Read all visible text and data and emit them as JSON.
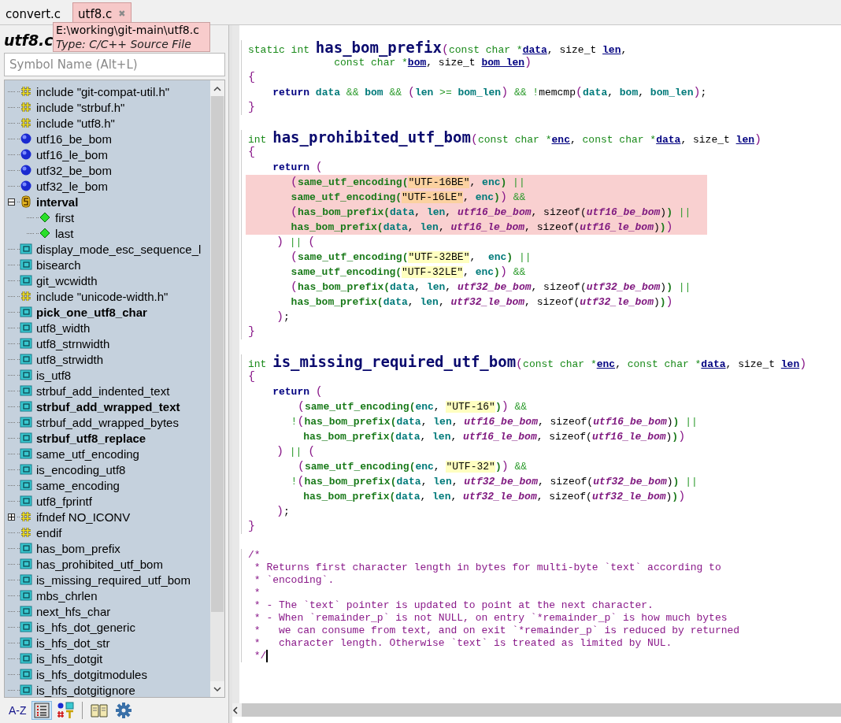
{
  "tabs": [
    {
      "label": "convert.c",
      "selected": false,
      "closable": false
    },
    {
      "label": "utf8.c",
      "selected": true,
      "closable": true,
      "close_glyph": "✖"
    }
  ],
  "tooltip": {
    "path": "E:\\working\\git-main\\utf8.c",
    "type": "Type: C/C++ Source File"
  },
  "outline": {
    "title": "utf8.c",
    "search": {
      "placeholder": "Symbol Name (Alt+L)"
    },
    "items": [
      {
        "kind": "include",
        "label": "include \"git-compat-util.h\"",
        "bold": false
      },
      {
        "kind": "include",
        "label": "include \"strbuf.h\"",
        "bold": false
      },
      {
        "kind": "include",
        "label": "include \"utf8.h\"",
        "bold": false
      },
      {
        "kind": "global",
        "label": "utf16_be_bom",
        "bold": false
      },
      {
        "kind": "global",
        "label": "utf16_le_bom",
        "bold": false
      },
      {
        "kind": "global",
        "label": "utf32_be_bom",
        "bold": false
      },
      {
        "kind": "global",
        "label": "utf32_le_bom",
        "bold": false
      },
      {
        "kind": "struct",
        "label": "interval",
        "bold": true,
        "expanded": true,
        "children": [
          {
            "kind": "field",
            "label": "first",
            "bold": false
          },
          {
            "kind": "field",
            "label": "last",
            "bold": false
          }
        ]
      },
      {
        "kind": "function",
        "label": "display_mode_esc_sequence_l",
        "bold": false
      },
      {
        "kind": "function",
        "label": "bisearch",
        "bold": false
      },
      {
        "kind": "function",
        "label": "git_wcwidth",
        "bold": false
      },
      {
        "kind": "include",
        "label": "include \"unicode-width.h\"",
        "bold": false
      },
      {
        "kind": "function",
        "label": "pick_one_utf8_char",
        "bold": true
      },
      {
        "kind": "function",
        "label": "utf8_width",
        "bold": false
      },
      {
        "kind": "function",
        "label": "utf8_strnwidth",
        "bold": false
      },
      {
        "kind": "function",
        "label": "utf8_strwidth",
        "bold": false
      },
      {
        "kind": "function",
        "label": "is_utf8",
        "bold": false
      },
      {
        "kind": "function",
        "label": "strbuf_add_indented_text",
        "bold": false
      },
      {
        "kind": "function",
        "label": "strbuf_add_wrapped_text",
        "bold": true
      },
      {
        "kind": "function",
        "label": "strbuf_add_wrapped_bytes",
        "bold": false
      },
      {
        "kind": "function",
        "label": "strbuf_utf8_replace",
        "bold": true
      },
      {
        "kind": "function",
        "label": "same_utf_encoding",
        "bold": false
      },
      {
        "kind": "function",
        "label": "is_encoding_utf8",
        "bold": false
      },
      {
        "kind": "function",
        "label": "same_encoding",
        "bold": false
      },
      {
        "kind": "function",
        "label": "utf8_fprintf",
        "bold": false
      },
      {
        "kind": "include",
        "label": "ifndef NO_ICONV",
        "bold": false,
        "expanded": false
      },
      {
        "kind": "include",
        "label": "endif",
        "bold": false
      },
      {
        "kind": "function",
        "label": "has_bom_prefix",
        "bold": false
      },
      {
        "kind": "function",
        "label": "has_prohibited_utf_bom",
        "bold": false
      },
      {
        "kind": "function",
        "label": "is_missing_required_utf_bom",
        "bold": false
      },
      {
        "kind": "function",
        "label": "mbs_chrlen",
        "bold": false
      },
      {
        "kind": "function",
        "label": "next_hfs_char",
        "bold": false
      },
      {
        "kind": "function",
        "label": "is_hfs_dot_generic",
        "bold": false
      },
      {
        "kind": "function",
        "label": "is_hfs_dot_str",
        "bold": false
      },
      {
        "kind": "function",
        "label": "is_hfs_dotgit",
        "bold": false
      },
      {
        "kind": "function",
        "label": "is_hfs_dotgitmodules",
        "bold": false
      },
      {
        "kind": "function",
        "label": "is_hfs_dotgitignore",
        "bold": false
      }
    ],
    "toolbar": [
      {
        "kind": "sort",
        "label": "A-Z",
        "selected": false
      },
      {
        "kind": "list",
        "selected": true
      },
      {
        "kind": "symbols",
        "selected": false
      },
      {
        "kind": "book",
        "selected": false
      },
      {
        "kind": "gear",
        "selected": false
      }
    ]
  },
  "editor": {
    "blocks": [
      {
        "lines": [
          {
            "highlighted": false,
            "tokens": [
              {
                "kind": "keyword",
                "text": "static int "
              },
              {
                "kind": "definition",
                "text": "has_bom_prefix"
              },
              {
                "kind": "paren",
                "text": "("
              },
              {
                "kind": "keyword",
                "text": "const char *"
              },
              {
                "kind": "param",
                "text": "data"
              },
              {
                "kind": "plain",
                "text": ", size_t "
              },
              {
                "kind": "param",
                "text": "len"
              },
              {
                "kind": "plain",
                "text": ","
              }
            ]
          },
          {
            "highlighted": false,
            "tokens": [
              {
                "kind": "keyword",
                "text": "              const char *"
              },
              {
                "kind": "param",
                "text": "bom"
              },
              {
                "kind": "plain",
                "text": ", size_t "
              },
              {
                "kind": "param",
                "text": "bom_len"
              },
              {
                "kind": "paren",
                "text": ")"
              }
            ]
          },
          {
            "highlighted": false,
            "tokens": [
              {
                "kind": "paren",
                "text": "{"
              }
            ]
          },
          {
            "highlighted": false,
            "tokens": [
              {
                "kind": "return",
                "text": "    return "
              },
              {
                "kind": "variable",
                "text": "data "
              },
              {
                "kind": "operator",
                "text": "&& "
              },
              {
                "kind": "variable",
                "text": "bom "
              },
              {
                "kind": "operator",
                "text": "&& "
              },
              {
                "kind": "paren",
                "text": "("
              },
              {
                "kind": "variable",
                "text": "len "
              },
              {
                "kind": "operator",
                "text": ">= "
              },
              {
                "kind": "variable",
                "text": "bom_len"
              },
              {
                "kind": "paren",
                "text": ")"
              },
              {
                "kind": "operator",
                "text": " && !"
              },
              {
                "kind": "plain",
                "text": "memcmp"
              },
              {
                "kind": "paren",
                "text": "("
              },
              {
                "kind": "variable",
                "text": "data"
              },
              {
                "kind": "plain",
                "text": ", "
              },
              {
                "kind": "variable",
                "text": "bom"
              },
              {
                "kind": "plain",
                "text": ", "
              },
              {
                "kind": "variable",
                "text": "bom_len"
              },
              {
                "kind": "paren",
                "text": ")"
              },
              {
                "kind": "plain",
                "text": ";"
              }
            ]
          },
          {
            "highlighted": false,
            "tokens": [
              {
                "kind": "paren",
                "text": "}"
              }
            ]
          }
        ]
      },
      {
        "lines": [
          {
            "highlighted": false,
            "tokens": [
              {
                "kind": "keyword",
                "text": "int "
              },
              {
                "kind": "definition",
                "text": "has_prohibited_utf_bom"
              },
              {
                "kind": "paren",
                "text": "("
              },
              {
                "kind": "keyword",
                "text": "const char *"
              },
              {
                "kind": "param",
                "text": "enc"
              },
              {
                "kind": "plain",
                "text": ", "
              },
              {
                "kind": "keyword",
                "text": "const char *"
              },
              {
                "kind": "param",
                "text": "data"
              },
              {
                "kind": "plain",
                "text": ", size_t "
              },
              {
                "kind": "param",
                "text": "len"
              },
              {
                "kind": "paren",
                "text": ")"
              }
            ]
          },
          {
            "highlighted": false,
            "tokens": [
              {
                "kind": "paren",
                "text": "{"
              }
            ]
          },
          {
            "highlighted": false,
            "tokens": [
              {
                "kind": "return",
                "text": "    return "
              },
              {
                "kind": "paren",
                "text": "("
              }
            ]
          },
          {
            "highlighted": true,
            "tokens": [
              {
                "kind": "paren",
                "text": "      ("
              },
              {
                "kind": "call",
                "text": "same_utf_encoding("
              },
              {
                "kind": "string",
                "text": "\"UTF-16BE\""
              },
              {
                "kind": "plain",
                "text": ", "
              },
              {
                "kind": "variable",
                "text": "enc"
              },
              {
                "kind": "call",
                "text": ")"
              },
              {
                "kind": "operator",
                "text": " ||"
              }
            ]
          },
          {
            "highlighted": true,
            "tokens": [
              {
                "kind": "call",
                "text": "       same_utf_encoding("
              },
              {
                "kind": "string",
                "text": "\"UTF-16LE\""
              },
              {
                "kind": "plain",
                "text": ", "
              },
              {
                "kind": "variable",
                "text": "enc"
              },
              {
                "kind": "call",
                "text": ")"
              },
              {
                "kind": "paren",
                "text": ")"
              },
              {
                "kind": "operator",
                "text": " &&"
              }
            ]
          },
          {
            "highlighted": true,
            "tokens": [
              {
                "kind": "paren",
                "text": "      ("
              },
              {
                "kind": "call",
                "text": "has_bom_prefix("
              },
              {
                "kind": "variable",
                "text": "data"
              },
              {
                "kind": "plain",
                "text": ", "
              },
              {
                "kind": "variable",
                "text": "len"
              },
              {
                "kind": "plain",
                "text": ", "
              },
              {
                "kind": "global",
                "text": "utf16_be_bom"
              },
              {
                "kind": "plain",
                "text": ", sizeof("
              },
              {
                "kind": "global",
                "text": "utf16_be_bom"
              },
              {
                "kind": "plain",
                "text": ")"
              },
              {
                "kind": "call",
                "text": ")"
              },
              {
                "kind": "operator",
                "text": " ||"
              }
            ]
          },
          {
            "highlighted": true,
            "tokens": [
              {
                "kind": "call",
                "text": "       has_bom_prefix("
              },
              {
                "kind": "variable",
                "text": "data"
              },
              {
                "kind": "plain",
                "text": ", "
              },
              {
                "kind": "variable",
                "text": "len"
              },
              {
                "kind": "plain",
                "text": ", "
              },
              {
                "kind": "global",
                "text": "utf16_le_bom"
              },
              {
                "kind": "plain",
                "text": ", sizeof("
              },
              {
                "kind": "global",
                "text": "utf16_le_bom"
              },
              {
                "kind": "plain",
                "text": ")"
              },
              {
                "kind": "call",
                "text": ")"
              },
              {
                "kind": "paren",
                "text": ")"
              }
            ]
          },
          {
            "highlighted": false,
            "tokens": [
              {
                "kind": "paren",
                "text": "    )"
              },
              {
                "kind": "operator",
                "text": " || "
              },
              {
                "kind": "paren",
                "text": "("
              }
            ]
          },
          {
            "highlighted": false,
            "tokens": [
              {
                "kind": "paren",
                "text": "      ("
              },
              {
                "kind": "call",
                "text": "same_utf_encoding("
              },
              {
                "kind": "string",
                "text": "\"UTF-32BE\""
              },
              {
                "kind": "plain",
                "text": ",  "
              },
              {
                "kind": "variable",
                "text": "enc"
              },
              {
                "kind": "call",
                "text": ")"
              },
              {
                "kind": "operator",
                "text": " ||"
              }
            ]
          },
          {
            "highlighted": false,
            "tokens": [
              {
                "kind": "call",
                "text": "       same_utf_encoding("
              },
              {
                "kind": "string",
                "text": "\"UTF-32LE\""
              },
              {
                "kind": "plain",
                "text": ", "
              },
              {
                "kind": "variable",
                "text": "enc"
              },
              {
                "kind": "call",
                "text": ")"
              },
              {
                "kind": "paren",
                "text": ")"
              },
              {
                "kind": "operator",
                "text": " &&"
              }
            ]
          },
          {
            "highlighted": false,
            "tokens": [
              {
                "kind": "paren",
                "text": "      ("
              },
              {
                "kind": "call",
                "text": "has_bom_prefix("
              },
              {
                "kind": "variable",
                "text": "data"
              },
              {
                "kind": "plain",
                "text": ", "
              },
              {
                "kind": "variable",
                "text": "len"
              },
              {
                "kind": "plain",
                "text": ", "
              },
              {
                "kind": "global",
                "text": "utf32_be_bom"
              },
              {
                "kind": "plain",
                "text": ", sizeof("
              },
              {
                "kind": "global",
                "text": "utf32_be_bom"
              },
              {
                "kind": "plain",
                "text": ")"
              },
              {
                "kind": "call",
                "text": ")"
              },
              {
                "kind": "operator",
                "text": " ||"
              }
            ]
          },
          {
            "highlighted": false,
            "tokens": [
              {
                "kind": "call",
                "text": "       has_bom_prefix("
              },
              {
                "kind": "variable",
                "text": "data"
              },
              {
                "kind": "plain",
                "text": ", "
              },
              {
                "kind": "variable",
                "text": "len"
              },
              {
                "kind": "plain",
                "text": ", "
              },
              {
                "kind": "global",
                "text": "utf32_le_bom"
              },
              {
                "kind": "plain",
                "text": ", sizeof("
              },
              {
                "kind": "global",
                "text": "utf32_le_bom"
              },
              {
                "kind": "plain",
                "text": ")"
              },
              {
                "kind": "call",
                "text": ")"
              },
              {
                "kind": "paren",
                "text": ")"
              }
            ]
          },
          {
            "highlighted": false,
            "tokens": [
              {
                "kind": "paren",
                "text": "    )"
              },
              {
                "kind": "plain",
                "text": ";"
              }
            ]
          },
          {
            "highlighted": false,
            "tokens": [
              {
                "kind": "paren",
                "text": "}"
              }
            ]
          }
        ]
      },
      {
        "lines": [
          {
            "highlighted": false,
            "tokens": [
              {
                "kind": "keyword",
                "text": "int "
              },
              {
                "kind": "definition",
                "text": "is_missing_required_utf_bom"
              },
              {
                "kind": "paren",
                "text": "("
              },
              {
                "kind": "keyword",
                "text": "const char *"
              },
              {
                "kind": "param",
                "text": "enc"
              },
              {
                "kind": "plain",
                "text": ", "
              },
              {
                "kind": "keyword",
                "text": "const char *"
              },
              {
                "kind": "param",
                "text": "data"
              },
              {
                "kind": "plain",
                "text": ", size_t "
              },
              {
                "kind": "param",
                "text": "len"
              },
              {
                "kind": "paren",
                "text": ")"
              }
            ]
          },
          {
            "highlighted": false,
            "tokens": [
              {
                "kind": "paren",
                "text": "{"
              }
            ]
          },
          {
            "highlighted": false,
            "tokens": [
              {
                "kind": "return",
                "text": "    return "
              },
              {
                "kind": "paren",
                "text": "("
              }
            ]
          },
          {
            "highlighted": false,
            "tokens": [
              {
                "kind": "paren",
                "text": "       ("
              },
              {
                "kind": "call",
                "text": "same_utf_encoding("
              },
              {
                "kind": "variable",
                "text": "enc"
              },
              {
                "kind": "plain",
                "text": ", "
              },
              {
                "kind": "string",
                "text": "\"UTF-16\""
              },
              {
                "kind": "call",
                "text": ")"
              },
              {
                "kind": "paren",
                "text": ")"
              },
              {
                "kind": "operator",
                "text": " &&"
              }
            ]
          },
          {
            "highlighted": false,
            "tokens": [
              {
                "kind": "operator",
                "text": "       !"
              },
              {
                "kind": "paren",
                "text": "("
              },
              {
                "kind": "call",
                "text": "has_bom_prefix("
              },
              {
                "kind": "variable",
                "text": "data"
              },
              {
                "kind": "plain",
                "text": ", "
              },
              {
                "kind": "variable",
                "text": "len"
              },
              {
                "kind": "plain",
                "text": ", "
              },
              {
                "kind": "global",
                "text": "utf16_be_bom"
              },
              {
                "kind": "plain",
                "text": ", sizeof("
              },
              {
                "kind": "global",
                "text": "utf16_be_bom"
              },
              {
                "kind": "plain",
                "text": ")"
              },
              {
                "kind": "call",
                "text": ")"
              },
              {
                "kind": "operator",
                "text": " ||"
              }
            ]
          },
          {
            "highlighted": false,
            "tokens": [
              {
                "kind": "call",
                "text": "         has_bom_prefix("
              },
              {
                "kind": "variable",
                "text": "data"
              },
              {
                "kind": "plain",
                "text": ", "
              },
              {
                "kind": "variable",
                "text": "len"
              },
              {
                "kind": "plain",
                "text": ", "
              },
              {
                "kind": "global",
                "text": "utf16_le_bom"
              },
              {
                "kind": "plain",
                "text": ", sizeof("
              },
              {
                "kind": "global",
                "text": "utf16_le_bom"
              },
              {
                "kind": "plain",
                "text": ")"
              },
              {
                "kind": "call",
                "text": ")"
              },
              {
                "kind": "paren",
                "text": ")"
              }
            ]
          },
          {
            "highlighted": false,
            "tokens": [
              {
                "kind": "paren",
                "text": "    )"
              },
              {
                "kind": "operator",
                "text": " || "
              },
              {
                "kind": "paren",
                "text": "("
              }
            ]
          },
          {
            "highlighted": false,
            "tokens": [
              {
                "kind": "paren",
                "text": "       ("
              },
              {
                "kind": "call",
                "text": "same_utf_encoding("
              },
              {
                "kind": "variable",
                "text": "enc"
              },
              {
                "kind": "plain",
                "text": ", "
              },
              {
                "kind": "string",
                "text": "\"UTF-32\""
              },
              {
                "kind": "call",
                "text": ")"
              },
              {
                "kind": "paren",
                "text": ")"
              },
              {
                "kind": "operator",
                "text": " &&"
              }
            ]
          },
          {
            "highlighted": false,
            "tokens": [
              {
                "kind": "operator",
                "text": "       !"
              },
              {
                "kind": "paren",
                "text": "("
              },
              {
                "kind": "call",
                "text": "has_bom_prefix("
              },
              {
                "kind": "variable",
                "text": "data"
              },
              {
                "kind": "plain",
                "text": ", "
              },
              {
                "kind": "variable",
                "text": "len"
              },
              {
                "kind": "plain",
                "text": ", "
              },
              {
                "kind": "global",
                "text": "utf32_be_bom"
              },
              {
                "kind": "plain",
                "text": ", sizeof("
              },
              {
                "kind": "global",
                "text": "utf32_be_bom"
              },
              {
                "kind": "plain",
                "text": ")"
              },
              {
                "kind": "call",
                "text": ")"
              },
              {
                "kind": "operator",
                "text": " ||"
              }
            ]
          },
          {
            "highlighted": false,
            "tokens": [
              {
                "kind": "call",
                "text": "         has_bom_prefix("
              },
              {
                "kind": "variable",
                "text": "data"
              },
              {
                "kind": "plain",
                "text": ", "
              },
              {
                "kind": "variable",
                "text": "len"
              },
              {
                "kind": "plain",
                "text": ", "
              },
              {
                "kind": "global",
                "text": "utf32_le_bom"
              },
              {
                "kind": "plain",
                "text": ", sizeof("
              },
              {
                "kind": "global",
                "text": "utf32_le_bom"
              },
              {
                "kind": "plain",
                "text": ")"
              },
              {
                "kind": "call",
                "text": ")"
              },
              {
                "kind": "paren",
                "text": ")"
              }
            ]
          },
          {
            "highlighted": false,
            "tokens": [
              {
                "kind": "paren",
                "text": "    )"
              },
              {
                "kind": "plain",
                "text": ";"
              }
            ]
          },
          {
            "highlighted": false,
            "tokens": [
              {
                "kind": "paren",
                "text": "}"
              }
            ]
          }
        ]
      },
      {
        "lines": [
          {
            "highlighted": false,
            "tokens": [
              {
                "kind": "comment",
                "text": "/*"
              }
            ]
          },
          {
            "highlighted": false,
            "tokens": [
              {
                "kind": "comment",
                "text": " * Returns first character length in bytes for multi-byte `text` according to"
              }
            ]
          },
          {
            "highlighted": false,
            "tokens": [
              {
                "kind": "comment",
                "text": " * `encoding`."
              }
            ]
          },
          {
            "highlighted": false,
            "tokens": [
              {
                "kind": "comment",
                "text": " *"
              }
            ]
          },
          {
            "highlighted": false,
            "tokens": [
              {
                "kind": "comment",
                "text": " * - The `text` pointer is updated to point at the next character."
              }
            ]
          },
          {
            "highlighted": false,
            "tokens": [
              {
                "kind": "comment",
                "text": " * - When `remainder_p` is not NULL, on entry `*remainder_p` is how much bytes"
              }
            ]
          },
          {
            "highlighted": false,
            "tokens": [
              {
                "kind": "comment",
                "text": " *   we can consume from text, and on exit `*remainder_p` is reduced by returned"
              }
            ]
          },
          {
            "highlighted": false,
            "tokens": [
              {
                "kind": "comment",
                "text": " *   character length. Otherwise `text` is treated as limited by NUL."
              }
            ]
          },
          {
            "highlighted": false,
            "cursor": true,
            "tokens": [
              {
                "kind": "comment",
                "text": " */"
              }
            ]
          }
        ]
      }
    ]
  }
}
